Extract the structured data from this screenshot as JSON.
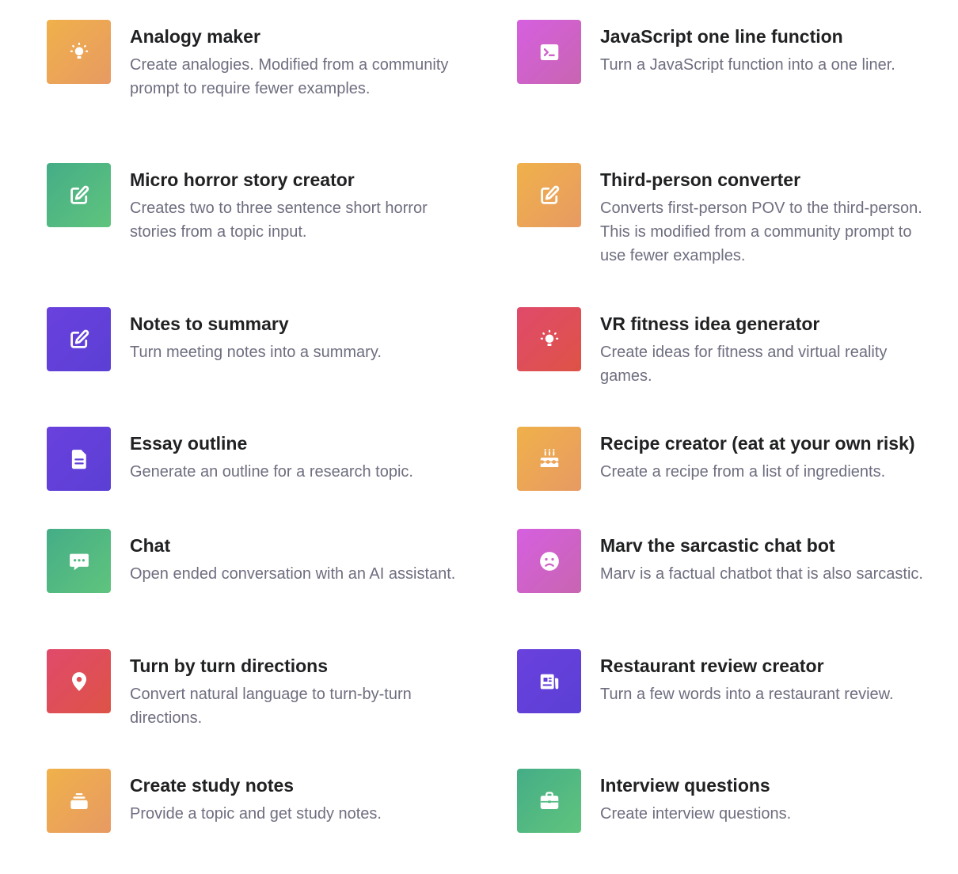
{
  "colors": {
    "orange": "#e9a254",
    "pink": "#cf62c8",
    "green": "#50b880",
    "purple": "#6340d9",
    "red": "#df4e58",
    "title_text": "#202123",
    "desc_text": "#6e6e80"
  },
  "examples": [
    {
      "title": "Analogy maker",
      "description": "Create analogies. Modified from a community prompt to require fewer examples.",
      "icon": "lightbulb-icon",
      "color": "orange"
    },
    {
      "title": "JavaScript one line function",
      "description": "Turn a JavaScript function into a one liner.",
      "icon": "terminal-icon",
      "color": "pink"
    },
    {
      "title": "Micro horror story creator",
      "description": "Creates two to three sentence short horror stories from a topic input.",
      "icon": "pencil-square-icon",
      "color": "green"
    },
    {
      "title": "Third-person converter",
      "description": "Converts first-person POV to the third-person. This is modified from a community prompt to use fewer examples.",
      "icon": "pencil-square-icon",
      "color": "orange"
    },
    {
      "title": "Notes to summary",
      "description": "Turn meeting notes into a summary.",
      "icon": "pencil-square-icon",
      "color": "purple"
    },
    {
      "title": "VR fitness idea generator",
      "description": "Create ideas for fitness and virtual reality games.",
      "icon": "lightbulb-icon",
      "color": "red"
    },
    {
      "title": "Essay outline",
      "description": "Generate an outline for a research topic.",
      "icon": "document-icon",
      "color": "purple"
    },
    {
      "title": "Recipe creator (eat at your own risk)",
      "description": "Create a recipe from a list of ingredients.",
      "icon": "cake-icon",
      "color": "orange"
    },
    {
      "title": "Chat",
      "description": "Open ended conversation with an AI assistant.",
      "icon": "chat-bubble-icon",
      "color": "green"
    },
    {
      "title": "Marv the sarcastic chat bot",
      "description": "Marv is a factual chatbot that is also sarcastic.",
      "icon": "sad-face-icon",
      "color": "pink"
    },
    {
      "title": "Turn by turn directions",
      "description": "Convert natural language to turn-by-turn directions.",
      "icon": "map-pin-icon",
      "color": "red"
    },
    {
      "title": "Restaurant review creator",
      "description": "Turn a few words into a restaurant review.",
      "icon": "newspaper-icon",
      "color": "purple"
    },
    {
      "title": "Create study notes",
      "description": "Provide a topic and get study notes.",
      "icon": "stack-icon",
      "color": "orange"
    },
    {
      "title": "Interview questions",
      "description": "Create interview questions.",
      "icon": "briefcase-icon",
      "color": "green"
    }
  ]
}
